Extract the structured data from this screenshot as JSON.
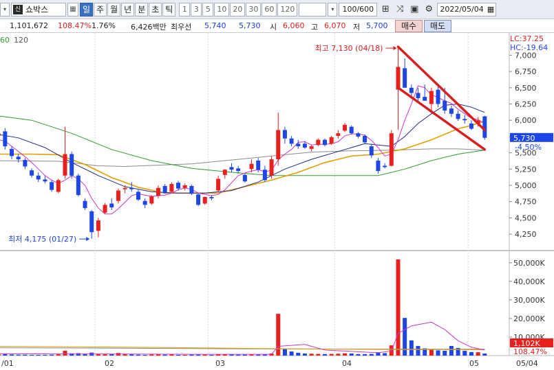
{
  "toolbar": {
    "dropdown_glyph": "▾",
    "stock_badge": "신",
    "stock_name": "쇼박스",
    "stock_icon_glyph": "▦",
    "periods": [
      {
        "label": "일",
        "active": true
      },
      {
        "label": "주",
        "active": false
      },
      {
        "label": "월",
        "active": false
      },
      {
        "label": "년",
        "active": false
      },
      {
        "label": "분",
        "active": false
      },
      {
        "label": "초",
        "active": false
      },
      {
        "label": "틱",
        "active": false
      }
    ],
    "intervals": [
      "1",
      "3",
      "5",
      "10",
      "20",
      "30",
      "60",
      "120"
    ],
    "combo_glyph": "▾",
    "count": "100/600",
    "icons": [
      "crosshair-icon",
      "compare-icon",
      "save-icon",
      "settings-icon"
    ],
    "icon_glyphs": [
      "⊞",
      "⤨",
      "▣",
      "⚙"
    ],
    "date": "2022/05/04",
    "calendar_glyph": "▦"
  },
  "quote": {
    "volume": "1,101,672",
    "volume_ratio": "108.47%",
    "turnover": "1.76%",
    "amount": "6,426백만",
    "preferred_label": "최우선",
    "ask": "5,740",
    "bid": "5,730",
    "open_label": "시",
    "open": "6,060",
    "high_label": "고",
    "high": "6,070",
    "low_label": "저",
    "low": "5,700",
    "buy_label": "매수",
    "sell_label": "매도"
  },
  "colors": {
    "up": "#e8201e",
    "down": "#1e46e6",
    "ma5": "#c837c8",
    "ma20": "#1f2a8a",
    "ma60": "#e0a000",
    "ma120": "#2e9a2e",
    "ma_long": "#8a8a8a",
    "trendline": "#d81f1f",
    "price_tag": "#1e46e6",
    "vol_tag": "#e8201e"
  },
  "chart_data": {
    "type": "candlestick",
    "ma_legend": [
      "60",
      "120"
    ],
    "lc_label": "LC:37.25",
    "hc_label": "HC:-19.64",
    "y_ticks": [
      "7,000",
      "6,750",
      "6,500",
      "6,250",
      "6,000",
      "5,750",
      "5,500",
      "5,250",
      "5,000",
      "4,750",
      "4,500",
      "4,250"
    ],
    "ylim": [
      4050,
      7300
    ],
    "current_price": "5,730",
    "current_change": "-4.50%",
    "high_annotation": "최고 7,130 (04/18)",
    "low_annotation": "최저 4,175 (01/27)",
    "x_ticks": [
      "/01",
      "02",
      "03",
      "04",
      "05",
      "05/04"
    ],
    "volume_ticks": [
      "50,000K",
      "40,000K",
      "30,000K",
      "20,000K",
      "10,000K"
    ],
    "volume_ylim": [
      0,
      54000
    ],
    "current_volume": "1,102K",
    "current_volume_ratio": "108.47%",
    "candles": [
      {
        "o": 5600,
        "h": 5680,
        "l": 5500,
        "c": 5580
      },
      {
        "o": 5760,
        "h": 5880,
        "l": 5700,
        "c": 5800
      },
      {
        "o": 5830,
        "h": 5880,
        "l": 5550,
        "c": 5600
      },
      {
        "o": 5560,
        "h": 5600,
        "l": 5400,
        "c": 5450
      },
      {
        "o": 5440,
        "h": 5480,
        "l": 5350,
        "c": 5400
      },
      {
        "o": 5390,
        "h": 5420,
        "l": 5250,
        "c": 5290
      },
      {
        "o": 5230,
        "h": 5260,
        "l": 5120,
        "c": 5150
      },
      {
        "o": 5150,
        "h": 5200,
        "l": 5050,
        "c": 5090
      },
      {
        "o": 5090,
        "h": 5140,
        "l": 5030,
        "c": 5060
      },
      {
        "o": 5050,
        "h": 5080,
        "l": 4900,
        "c": 4930
      },
      {
        "o": 4900,
        "h": 5100,
        "l": 4880,
        "c": 5080
      },
      {
        "o": 5150,
        "h": 5900,
        "l": 5100,
        "c": 5480
      },
      {
        "o": 5480,
        "h": 5520,
        "l": 5100,
        "c": 5150
      },
      {
        "o": 5150,
        "h": 5180,
        "l": 4830,
        "c": 4850
      },
      {
        "o": 4760,
        "h": 4800,
        "l": 4620,
        "c": 4650
      },
      {
        "o": 4600,
        "h": 4620,
        "l": 4180,
        "c": 4280
      },
      {
        "o": 4300,
        "h": 4500,
        "l": 4200,
        "c": 4460
      },
      {
        "o": 4580,
        "h": 4730,
        "l": 4560,
        "c": 4700
      },
      {
        "o": 4720,
        "h": 4800,
        "l": 4620,
        "c": 4660
      },
      {
        "o": 4760,
        "h": 4950,
        "l": 4720,
        "c": 4920
      },
      {
        "o": 4940,
        "h": 5000,
        "l": 4880,
        "c": 4960
      },
      {
        "o": 4960,
        "h": 5050,
        "l": 4900,
        "c": 4940
      },
      {
        "o": 4900,
        "h": 4930,
        "l": 4760,
        "c": 4780
      },
      {
        "o": 4760,
        "h": 4800,
        "l": 4650,
        "c": 4700
      },
      {
        "o": 4720,
        "h": 4850,
        "l": 4700,
        "c": 4830
      },
      {
        "o": 4840,
        "h": 5000,
        "l": 4800,
        "c": 4960
      },
      {
        "o": 4990,
        "h": 5020,
        "l": 4870,
        "c": 4880
      },
      {
        "o": 4900,
        "h": 5050,
        "l": 4880,
        "c": 5020
      },
      {
        "o": 5040,
        "h": 5070,
        "l": 4920,
        "c": 4950
      },
      {
        "o": 4960,
        "h": 5030,
        "l": 4920,
        "c": 5000
      },
      {
        "o": 4990,
        "h": 5010,
        "l": 4850,
        "c": 4870
      },
      {
        "o": 4860,
        "h": 4880,
        "l": 4680,
        "c": 4700
      },
      {
        "o": 4720,
        "h": 4830,
        "l": 4700,
        "c": 4820
      },
      {
        "o": 4820,
        "h": 4850,
        "l": 4770,
        "c": 4800
      },
      {
        "o": 4920,
        "h": 5150,
        "l": 4900,
        "c": 5100
      },
      {
        "o": 5160,
        "h": 5250,
        "l": 5100,
        "c": 5240
      },
      {
        "o": 5280,
        "h": 5340,
        "l": 5200,
        "c": 5240
      },
      {
        "o": 5260,
        "h": 5300,
        "l": 5180,
        "c": 5220
      },
      {
        "o": 5160,
        "h": 5180,
        "l": 5040,
        "c": 5060
      },
      {
        "o": 5250,
        "h": 5400,
        "l": 5200,
        "c": 5330
      },
      {
        "o": 5380,
        "h": 5420,
        "l": 5200,
        "c": 5240
      },
      {
        "o": 5240,
        "h": 5300,
        "l": 5050,
        "c": 5080
      },
      {
        "o": 5150,
        "h": 5450,
        "l": 5100,
        "c": 5400
      },
      {
        "o": 5400,
        "h": 6120,
        "l": 5300,
        "c": 5850
      },
      {
        "o": 5850,
        "h": 5900,
        "l": 5640,
        "c": 5720
      },
      {
        "o": 5720,
        "h": 5760,
        "l": 5600,
        "c": 5640
      },
      {
        "o": 5640,
        "h": 5700,
        "l": 5560,
        "c": 5600
      },
      {
        "o": 5640,
        "h": 5680,
        "l": 5560,
        "c": 5580
      },
      {
        "o": 5560,
        "h": 5620,
        "l": 5520,
        "c": 5600
      },
      {
        "o": 5620,
        "h": 5720,
        "l": 5600,
        "c": 5700
      },
      {
        "o": 5700,
        "h": 5720,
        "l": 5600,
        "c": 5620
      },
      {
        "o": 5640,
        "h": 5760,
        "l": 5620,
        "c": 5740
      },
      {
        "o": 5760,
        "h": 5850,
        "l": 5720,
        "c": 5800
      },
      {
        "o": 5840,
        "h": 5960,
        "l": 5820,
        "c": 5930
      },
      {
        "o": 5900,
        "h": 5920,
        "l": 5780,
        "c": 5800
      },
      {
        "o": 5800,
        "h": 5820,
        "l": 5720,
        "c": 5750
      },
      {
        "o": 5760,
        "h": 5780,
        "l": 5640,
        "c": 5660
      },
      {
        "o": 5600,
        "h": 5640,
        "l": 5420,
        "c": 5460
      },
      {
        "o": 5380,
        "h": 5420,
        "l": 5180,
        "c": 5220
      },
      {
        "o": 5300,
        "h": 5340,
        "l": 5260,
        "c": 5280
      },
      {
        "o": 5300,
        "h": 5850,
        "l": 5290,
        "c": 5800
      },
      {
        "o": 6470,
        "h": 7130,
        "l": 5850,
        "c": 6820
      },
      {
        "o": 6800,
        "h": 6950,
        "l": 6500,
        "c": 6500
      },
      {
        "o": 6500,
        "h": 6550,
        "l": 6350,
        "c": 6420
      },
      {
        "o": 6420,
        "h": 6500,
        "l": 6280,
        "c": 6340
      },
      {
        "o": 6360,
        "h": 6550,
        "l": 6300,
        "c": 6300
      },
      {
        "o": 6250,
        "h": 6500,
        "l": 6100,
        "c": 6450
      },
      {
        "o": 6470,
        "h": 6520,
        "l": 6200,
        "c": 6250
      },
      {
        "o": 6300,
        "h": 6500,
        "l": 6100,
        "c": 6150
      },
      {
        "o": 6180,
        "h": 6220,
        "l": 6050,
        "c": 6100
      },
      {
        "o": 6100,
        "h": 6150,
        "l": 5990,
        "c": 6020
      },
      {
        "o": 6020,
        "h": 6080,
        "l": 5950,
        "c": 6000
      },
      {
        "o": 5950,
        "h": 6000,
        "l": 5850,
        "c": 5870
      },
      {
        "o": 5950,
        "h": 6050,
        "l": 5900,
        "c": 6000
      },
      {
        "o": 6060,
        "h": 6070,
        "l": 5700,
        "c": 5730
      }
    ],
    "volumes": [
      1100,
      800,
      900,
      600,
      500,
      500,
      400,
      400,
      400,
      500,
      700,
      2600,
      1200,
      1300,
      1000,
      1600,
      900,
      700,
      800,
      1400,
      800,
      700,
      500,
      400,
      600,
      800,
      500,
      600,
      400,
      400,
      500,
      500,
      500,
      400,
      600,
      800,
      700,
      500,
      500,
      600,
      500,
      700,
      1100,
      22500,
      3600,
      2200,
      1500,
      1100,
      1000,
      900,
      800,
      900,
      1000,
      1200,
      1100,
      800,
      800,
      900,
      1800,
      1300,
      5500,
      51800,
      20300,
      8200,
      5200,
      3900,
      3200,
      2800,
      2600,
      5200,
      4100,
      2600,
      1900,
      1800,
      1100
    ],
    "ma_lines": {
      "ma5": [
        [
          0,
          5700
        ],
        [
          1,
          5700
        ],
        [
          2,
          5680
        ],
        [
          3,
          5600
        ],
        [
          4,
          5520
        ],
        [
          5,
          5440
        ],
        [
          6,
          5350
        ],
        [
          7,
          5250
        ],
        [
          8,
          5150
        ],
        [
          9,
          5080
        ],
        [
          10,
          5030
        ],
        [
          11,
          5080
        ],
        [
          12,
          5150
        ],
        [
          13,
          5100
        ],
        [
          14,
          5000
        ],
        [
          15,
          4800
        ],
        [
          16,
          4650
        ],
        [
          17,
          4560
        ],
        [
          18,
          4560
        ],
        [
          19,
          4640
        ],
        [
          20,
          4740
        ],
        [
          21,
          4840
        ],
        [
          22,
          4870
        ],
        [
          23,
          4850
        ],
        [
          24,
          4830
        ],
        [
          25,
          4840
        ],
        [
          26,
          4850
        ],
        [
          27,
          4880
        ],
        [
          28,
          4930
        ],
        [
          29,
          4960
        ],
        [
          30,
          4940
        ],
        [
          31,
          4880
        ],
        [
          32,
          4860
        ],
        [
          33,
          4840
        ],
        [
          34,
          4860
        ],
        [
          35,
          4930
        ],
        [
          36,
          5040
        ],
        [
          37,
          5150
        ],
        [
          38,
          5190
        ],
        [
          39,
          5220
        ],
        [
          40,
          5240
        ],
        [
          41,
          5210
        ],
        [
          42,
          5230
        ],
        [
          43,
          5390
        ],
        [
          44,
          5480
        ],
        [
          45,
          5550
        ],
        [
          46,
          5660
        ],
        [
          47,
          5670
        ],
        [
          48,
          5620
        ],
        [
          49,
          5630
        ],
        [
          50,
          5630
        ],
        [
          51,
          5640
        ],
        [
          52,
          5670
        ],
        [
          53,
          5760
        ],
        [
          54,
          5790
        ],
        [
          55,
          5790
        ],
        [
          56,
          5770
        ],
        [
          57,
          5690
        ],
        [
          58,
          5580
        ],
        [
          59,
          5450
        ],
        [
          60,
          5480
        ],
        [
          61,
          5700
        ],
        [
          62,
          6000
        ],
        [
          63,
          6250
        ],
        [
          64,
          6530
        ],
        [
          65,
          6500
        ],
        [
          66,
          6390
        ],
        [
          67,
          6350
        ],
        [
          68,
          6300
        ],
        [
          69,
          6260
        ],
        [
          70,
          6170
        ],
        [
          71,
          6100
        ],
        [
          72,
          6030
        ],
        [
          73,
          6010
        ],
        [
          74,
          5950
        ]
      ],
      "ma20": [
        [
          0,
          5800
        ],
        [
          4,
          5730
        ],
        [
          8,
          5580
        ],
        [
          12,
          5350
        ],
        [
          16,
          5150
        ],
        [
          20,
          4980
        ],
        [
          24,
          4900
        ],
        [
          28,
          4880
        ],
        [
          32,
          4880
        ],
        [
          36,
          4920
        ],
        [
          40,
          5050
        ],
        [
          44,
          5250
        ],
        [
          48,
          5400
        ],
        [
          52,
          5520
        ],
        [
          56,
          5640
        ],
        [
          58,
          5620
        ],
        [
          60,
          5600
        ],
        [
          62,
          5750
        ],
        [
          64,
          5950
        ],
        [
          66,
          6100
        ],
        [
          68,
          6230
        ],
        [
          70,
          6250
        ],
        [
          72,
          6200
        ],
        [
          74,
          6120
        ]
      ],
      "ma60": [
        [
          0,
          5480
        ],
        [
          6,
          5480
        ],
        [
          10,
          5470
        ],
        [
          14,
          5320
        ],
        [
          18,
          5120
        ],
        [
          22,
          4970
        ],
        [
          26,
          4880
        ],
        [
          30,
          4880
        ],
        [
          34,
          4880
        ],
        [
          38,
          4980
        ],
        [
          42,
          5080
        ],
        [
          46,
          5200
        ],
        [
          50,
          5350
        ],
        [
          54,
          5450
        ],
        [
          58,
          5480
        ],
        [
          62,
          5560
        ],
        [
          66,
          5700
        ],
        [
          70,
          5870
        ],
        [
          72,
          5920
        ],
        [
          74,
          5990
        ]
      ],
      "ma120": [
        [
          0,
          6080
        ],
        [
          6,
          6000
        ],
        [
          12,
          5800
        ],
        [
          18,
          5550
        ],
        [
          24,
          5380
        ],
        [
          30,
          5260
        ],
        [
          36,
          5200
        ],
        [
          42,
          5150
        ],
        [
          48,
          5150
        ],
        [
          54,
          5150
        ],
        [
          58,
          5150
        ],
        [
          62,
          5250
        ],
        [
          66,
          5380
        ],
        [
          70,
          5480
        ],
        [
          74,
          5540
        ]
      ],
      "ma_long": [
        [
          0,
          5380
        ],
        [
          10,
          5370
        ],
        [
          16,
          5300
        ],
        [
          20,
          5290
        ],
        [
          30,
          5330
        ],
        [
          40,
          5430
        ],
        [
          48,
          5510
        ],
        [
          54,
          5530
        ],
        [
          60,
          5540
        ],
        [
          66,
          5560
        ],
        [
          70,
          5560
        ],
        [
          74,
          5540
        ]
      ]
    },
    "volume_ma": {
      "ma5": [
        [
          0,
          1000
        ],
        [
          10,
          900
        ],
        [
          20,
          800
        ],
        [
          30,
          700
        ],
        [
          40,
          700
        ],
        [
          42,
          700
        ],
        [
          43,
          5000
        ],
        [
          47,
          6000
        ],
        [
          50,
          3000
        ],
        [
          58,
          1500
        ],
        [
          60,
          2500
        ],
        [
          61,
          12000
        ],
        [
          63,
          16000
        ],
        [
          66,
          18000
        ],
        [
          68,
          14000
        ],
        [
          70,
          8000
        ],
        [
          72,
          4500
        ],
        [
          74,
          3000
        ]
      ],
      "ma20": [
        [
          0,
          5000
        ],
        [
          10,
          4800
        ],
        [
          20,
          4500
        ],
        [
          30,
          4200
        ],
        [
          40,
          3800
        ],
        [
          50,
          3500
        ],
        [
          60,
          3300
        ],
        [
          70,
          3200
        ],
        [
          74,
          3100
        ]
      ],
      "ma60": [
        [
          0,
          4200
        ],
        [
          20,
          4000
        ],
        [
          40,
          3600
        ],
        [
          60,
          3500
        ],
        [
          74,
          3400
        ]
      ]
    },
    "trendlines": [
      [
        [
          61,
          7130
        ],
        [
          74,
          5850
        ]
      ],
      [
        [
          61,
          6500
        ],
        [
          74,
          5550
        ]
      ]
    ]
  }
}
